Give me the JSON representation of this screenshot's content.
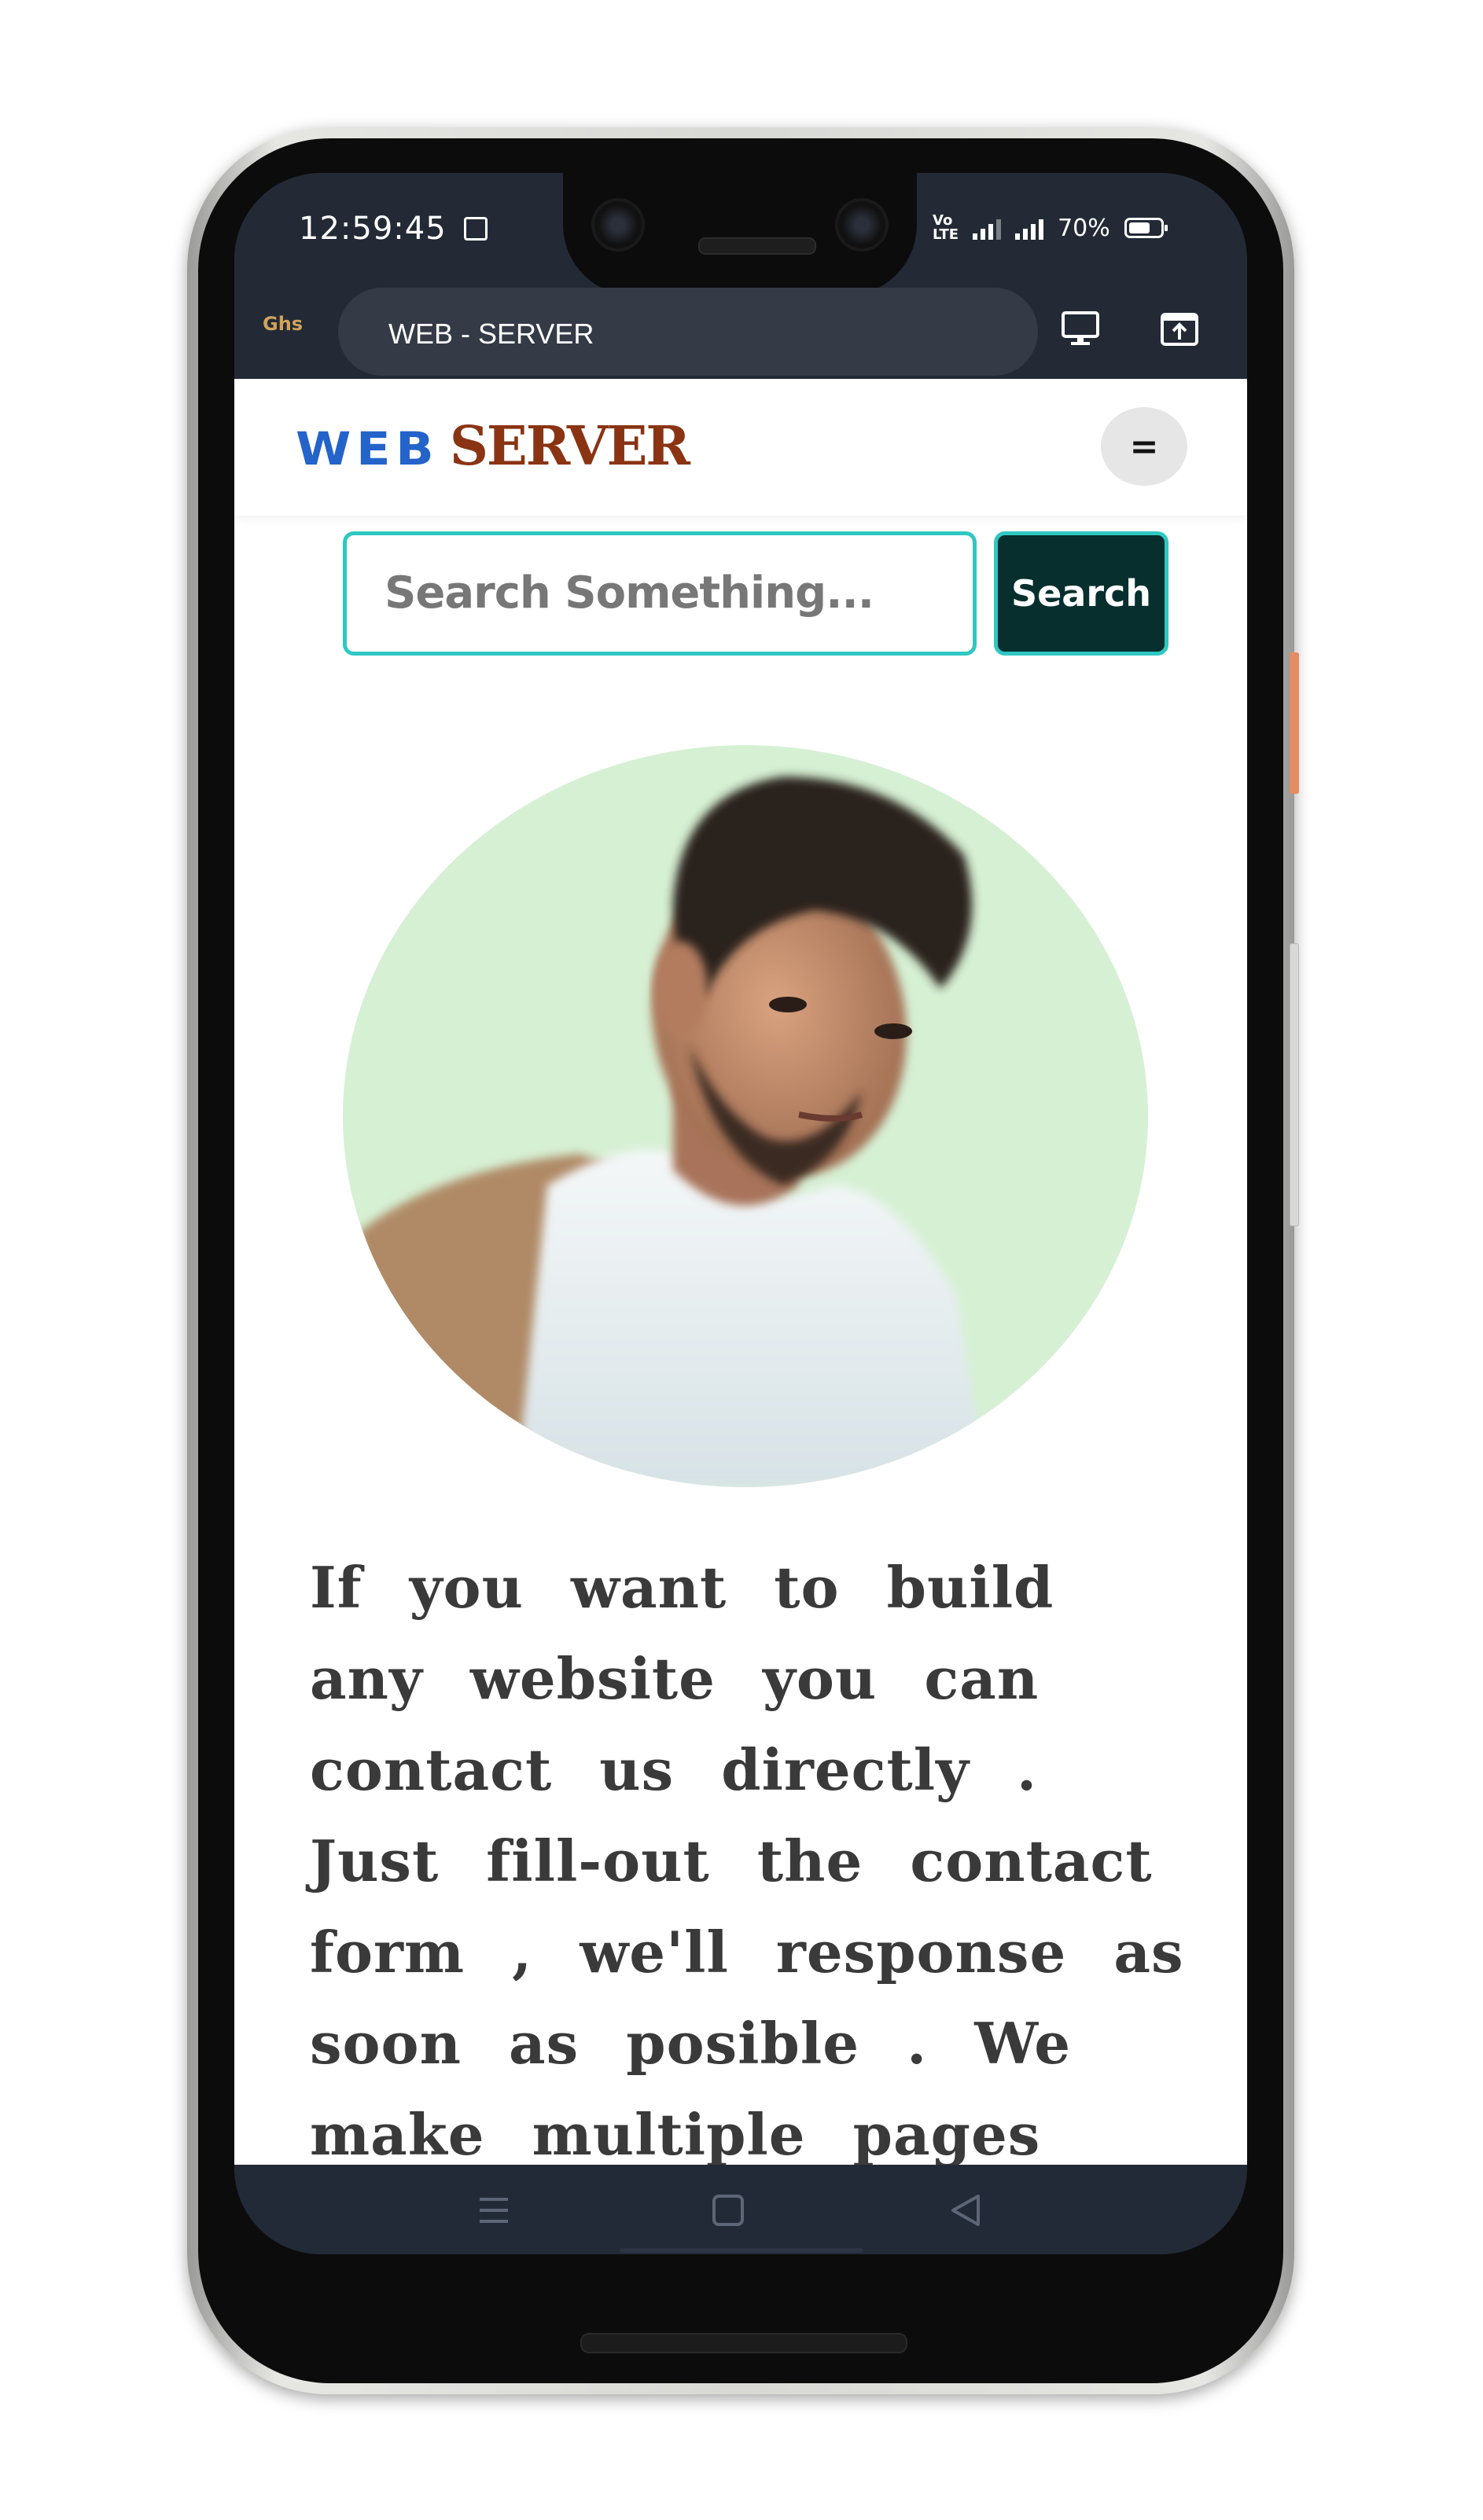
{
  "status_bar": {
    "time": "12:59:45",
    "network_label": "Vo\nLTE",
    "battery_label": "70%",
    "battery_level": 0.7
  },
  "browser": {
    "badge": "Ghs",
    "address_text": "WEB - SERVER",
    "desktop_icon": "desktop-icon",
    "share_icon": "open-in-icon"
  },
  "site": {
    "logo_web": "WEB",
    "logo_server": "SERVER",
    "menu_label": "=",
    "search_placeholder": "Search Something...",
    "search_button": "Search",
    "profile_image": "profile-photo",
    "paragraph": "If you want to build any website you can contact us directly . Just fill-out the contact form , we'll response as soon as posible . We make multiple pages"
  },
  "colors": {
    "logo_web": "#2463c9",
    "logo_server": "#8a3413",
    "search_border": "#2fc7c1",
    "search_button_bg": "#062f2e",
    "avatar_bg": "#d6f0d4"
  }
}
